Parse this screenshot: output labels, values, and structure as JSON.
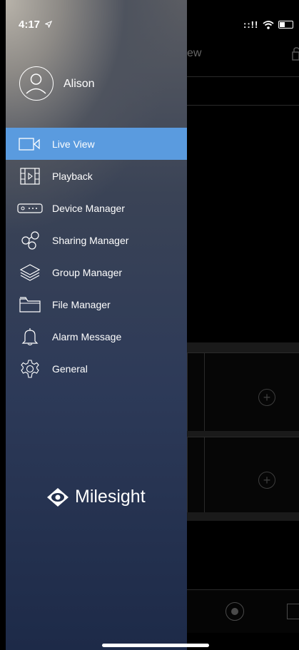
{
  "status_bar": {
    "time": "4:17",
    "signal": "::!!"
  },
  "background": {
    "header_text": "ew"
  },
  "user": {
    "name": "Alison"
  },
  "menu": {
    "items": [
      {
        "label": "Live View",
        "icon": "camera-icon",
        "active": true
      },
      {
        "label": "Playback",
        "icon": "film-icon",
        "active": false
      },
      {
        "label": "Device Manager",
        "icon": "nvr-device-icon",
        "active": false
      },
      {
        "label": "Sharing Manager",
        "icon": "share-icon",
        "active": false
      },
      {
        "label": "Group Manager",
        "icon": "layers-icon",
        "active": false
      },
      {
        "label": "File Manager",
        "icon": "folder-icon",
        "active": false
      },
      {
        "label": "Alarm Message",
        "icon": "bell-icon",
        "active": false
      },
      {
        "label": "General",
        "icon": "gear-icon",
        "active": false
      }
    ]
  },
  "brand": {
    "name": "Milesight"
  },
  "colors": {
    "accent": "#5a9bdf"
  }
}
